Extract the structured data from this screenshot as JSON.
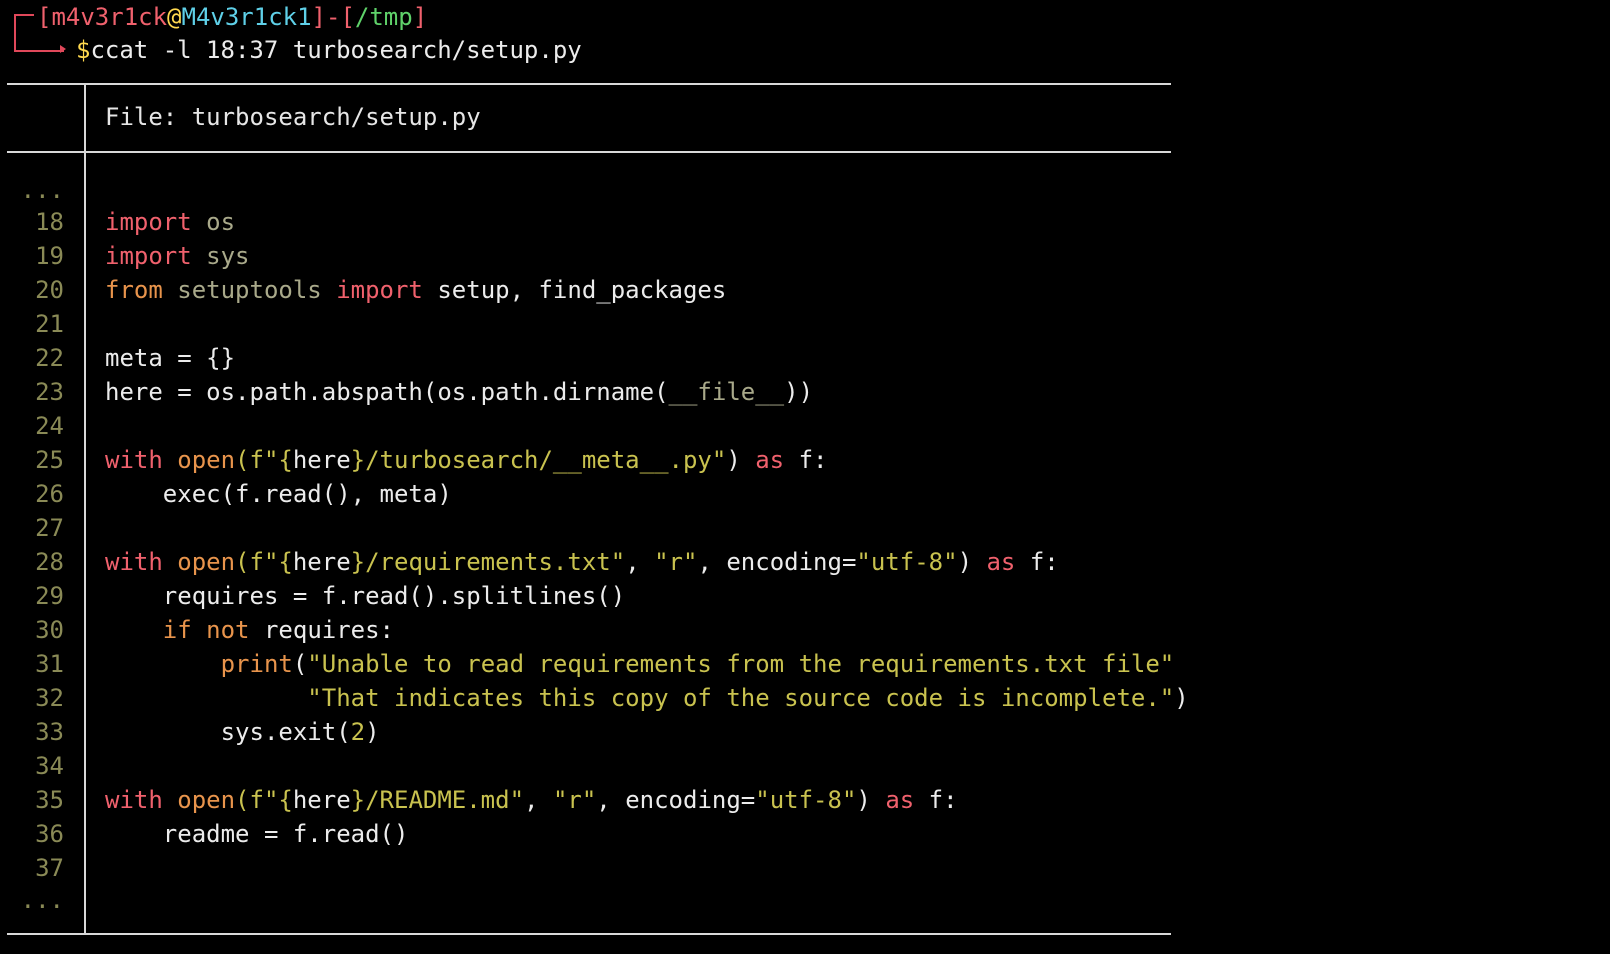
{
  "colors": {
    "background": "#000000",
    "keyword": "#f0616d",
    "builtin": "#e8944c",
    "string": "#c9c24f",
    "line_number": "#8a8a56",
    "prompt_user": "#f0616d",
    "prompt_at": "#ffd94f",
    "prompt_host": "#5fd0e8",
    "prompt_path": "#5fd26a"
  },
  "prompt": {
    "open_bracket": "[",
    "user": "m4v3r1ck",
    "at": "@",
    "host": "M4v3r1ck1",
    "close_bracket": "]",
    "dash": "-",
    "path_open": "[",
    "path": "/tmp",
    "path_close": "]",
    "dollar": "$",
    "command": "ccat -l 18:37 turbosearch/setup.py"
  },
  "file_header": "File: turbosearch/setup.py",
  "gutter": {
    "ellipsis_top": "...",
    "ellipsis_bottom": "...",
    "line_numbers": [
      "18",
      "19",
      "20",
      "21",
      "22",
      "23",
      "24",
      "25",
      "26",
      "27",
      "28",
      "29",
      "30",
      "31",
      "32",
      "33",
      "34",
      "35",
      "36",
      "37"
    ]
  },
  "code": {
    "l18": {
      "a": "import",
      "b": " os"
    },
    "l19": {
      "a": "import",
      "b": " sys"
    },
    "l20": {
      "a": "from",
      "b": " setuptools ",
      "c": "import",
      "d": " setup, find_packages"
    },
    "l22": {
      "a": "meta = {}"
    },
    "l23": {
      "a": "here = os.path.abspath(os.path.dirname(",
      "b": "__file__",
      "c": "))"
    },
    "l25": {
      "a": "with",
      "b": " ",
      "c": "open",
      "d": "(f\"{",
      "e": "here",
      "f": "}/turbosearch/__meta__.py\"",
      "g": ") ",
      "h": "as",
      "i": " f:"
    },
    "l26": {
      "a": "    exec(f.read(), meta)"
    },
    "l28": {
      "a": "with",
      "b": " ",
      "c": "open",
      "d": "(f\"{",
      "e": "here",
      "f": "}/requirements.txt\"",
      "g": ", ",
      "h": "\"r\"",
      "i": ", encoding=",
      "j": "\"utf-8\"",
      "k": ") ",
      "l": "as",
      "m": " f:"
    },
    "l29": {
      "a": "    requires = f.read().splitlines()"
    },
    "l30": {
      "a": "    ",
      "b": "if",
      "c": " ",
      "d": "not",
      "e": " requires:"
    },
    "l31": {
      "a": "        ",
      "b": "print",
      "c": "(",
      "d": "\"Unable to read requirements from the requirements.txt file\""
    },
    "l32": {
      "a": "              ",
      "b": "\"That indicates this copy of the source code is incomplete.\"",
      "c": ")"
    },
    "l33": {
      "a": "        sys.exit(",
      "b": "2",
      "c": ")"
    },
    "l35": {
      "a": "with",
      "b": " ",
      "c": "open",
      "d": "(f\"{",
      "e": "here",
      "f": "}/README.md\"",
      "g": ", ",
      "h": "\"r\"",
      "i": ", encoding=",
      "j": "\"utf-8\"",
      "k": ") ",
      "l": "as",
      "m": " f:"
    },
    "l36": {
      "a": "    readme = f.read()"
    }
  }
}
